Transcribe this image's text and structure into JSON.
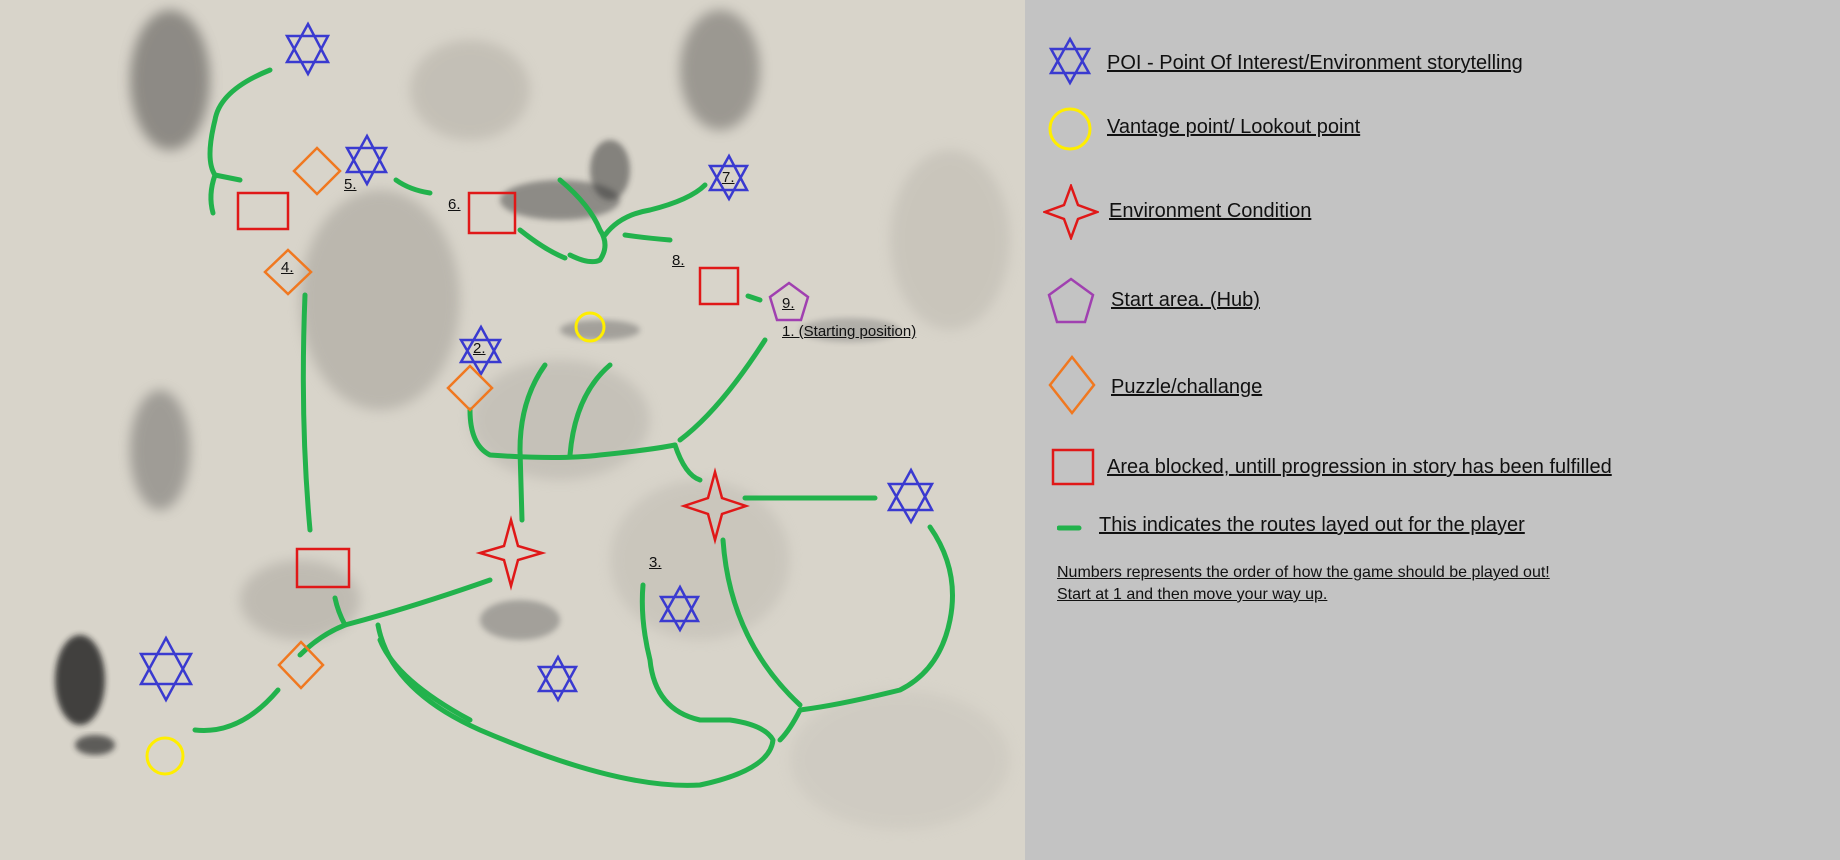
{
  "legend": {
    "poi": "POI - Point Of Interest/Environment storytelling",
    "vantage": "Vantage point/ Lookout point",
    "environment": "Environment Condition",
    "start": "Start area. (Hub)",
    "puzzle": "Puzzle/challange",
    "blocked": "Area blocked, untill progression in story has been fulfilled",
    "routes": "This indicates the routes layed out for the player"
  },
  "notes": {
    "line1": "Numbers represents the order of how the game should be played out!",
    "line2": "Start at 1 and then move your way up."
  },
  "map_labels": {
    "n1": "1. (Starting position)",
    "n2": "2.",
    "n3": "3.",
    "n4": "4.",
    "n5": "5.",
    "n6": "6.",
    "n7": "7.",
    "n8": "8.",
    "n9": "9."
  },
  "colors": {
    "poi": "#3a3ad0",
    "vantage": "#ffee00",
    "environment": "#e01818",
    "start": "#a040b0",
    "puzzle": "#f07820",
    "blocked": "#e01818",
    "route": "#22b24c",
    "legend_bg": "#c3c3c3"
  },
  "icons": {
    "poi": "six-point-star-icon",
    "vantage": "circle-icon",
    "environment": "four-point-star-icon",
    "start": "pentagon-icon",
    "puzzle": "diamond-icon",
    "blocked": "square-icon",
    "route": "green-dash-icon"
  }
}
